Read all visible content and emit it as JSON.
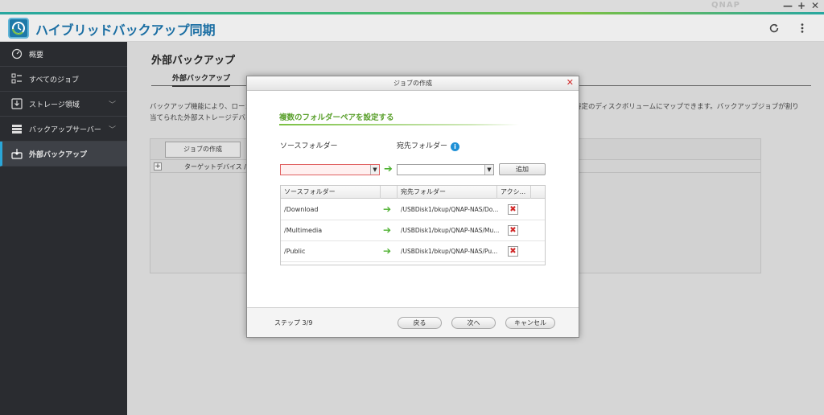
{
  "window": {
    "brand": "QNAP",
    "minimize": "—",
    "maximize": "+",
    "close": "✕"
  },
  "app": {
    "title": "ハイブリッドバックアップ同期"
  },
  "header_icons": [
    "refresh-icon",
    "more-vert-icon"
  ],
  "sidebar": {
    "items": [
      {
        "label": "概要",
        "icon": "dashboard-icon"
      },
      {
        "label": "すべてのジョブ",
        "icon": "job-list-icon"
      },
      {
        "label": "ストレージ領域",
        "icon": "storage-icon",
        "expandable": true
      },
      {
        "label": "バックアップサーバー",
        "icon": "server-icon",
        "expandable": true
      },
      {
        "label": "外部バックアップ",
        "icon": "external-backup-icon",
        "active": true
      }
    ],
    "active_color": "#2aa6d8"
  },
  "main": {
    "page_title": "外部バックアップ",
    "tab_label": "外部バックアップ",
    "description_left": "バックアップ機能により、ローカ",
    "description_left_2": "当てられた外部ストレージデバイ",
    "description_right": "特定のディスクボリュームにマップできます。バックアップジョブが割り",
    "create_job_button": "ジョブの作成",
    "table_column": "ターゲットデバイス / シ"
  },
  "modal": {
    "title": "ジョブの作成",
    "heading": "複数のフォルダーペアを設定する",
    "source_label": "ソースフォルダー",
    "dest_label": "宛先フォルダー",
    "source_value": "",
    "dest_value": "",
    "add_button": "追加",
    "grid": {
      "columns": [
        "ソースフォルダー",
        "宛先フォルダー",
        "アクシ..."
      ],
      "rows": [
        {
          "source": "/Download",
          "dest": "/USBDisk1/bkup/QNAP-NAS/Do..."
        },
        {
          "source": "/Multimedia",
          "dest": "/USBDisk1/bkup/QNAP-NAS/Mu..."
        },
        {
          "source": "/Public",
          "dest": "/USBDisk1/bkup/QNAP-NAS/Pu..."
        }
      ]
    },
    "step": "ステップ 3/9",
    "back_button": "戻る",
    "next_button": "次へ",
    "cancel_button": "キャンセル",
    "accent_color": "#5aa02c"
  }
}
